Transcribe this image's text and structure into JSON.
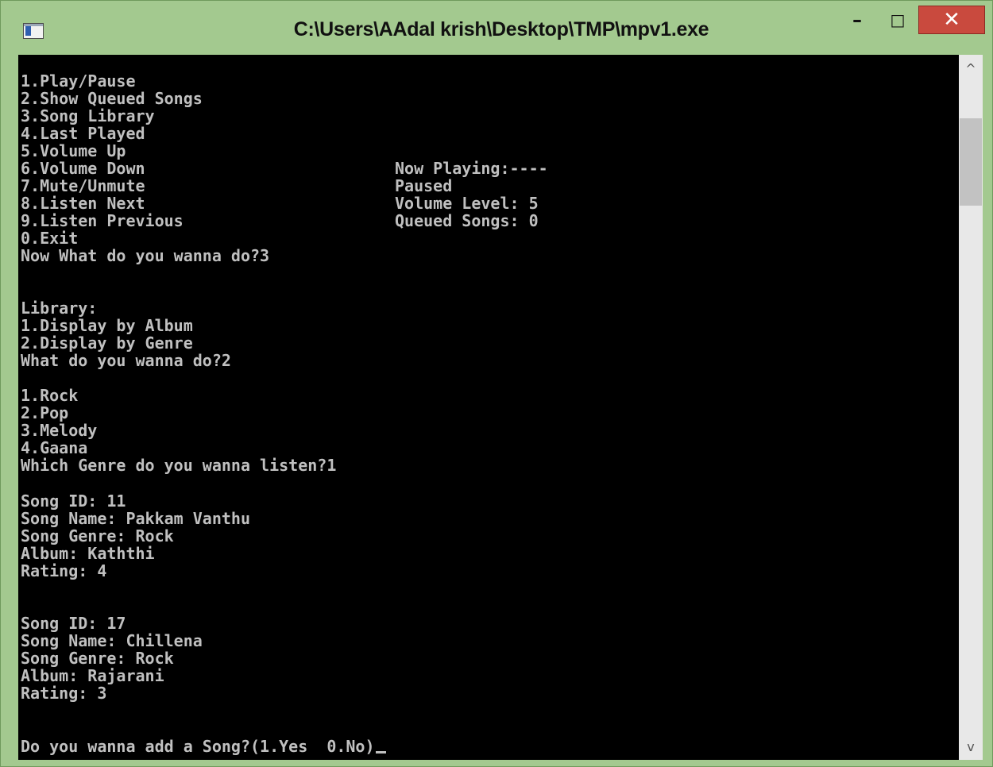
{
  "window": {
    "title": "C:\\Users\\AAdal krish\\Desktop\\TMP\\mpv1.exe",
    "minimize_label": "–",
    "maximize_label": "□",
    "close_label": "✕"
  },
  "menu": [
    "1.Play/Pause",
    "2.Show Queued Songs",
    "3.Song Library",
    "4.Last Played",
    "5.Volume Up",
    "6.Volume Down",
    "7.Mute/Unmute",
    "8.Listen Next",
    "9.Listen Previous",
    "0.Exit",
    "Now What do you wanna do?3"
  ],
  "status": [
    "Now Playing:----",
    "Paused",
    "Volume Level: 5",
    "Queued Songs: 0"
  ],
  "library": [
    "Library:",
    "1.Display by Album",
    "2.Display by Genre",
    "What do you wanna do?2"
  ],
  "genres": [
    "1.Rock",
    "2.Pop",
    "3.Melody",
    "4.Gaana",
    "Which Genre do you wanna listen?1"
  ],
  "song1": [
    "Song ID: 11",
    "Song Name: Pakkam Vanthu",
    "Song Genre: Rock",
    "Album: Kaththi",
    "Rating: 4"
  ],
  "song2": [
    "Song ID: 17",
    "Song Name: Chillena",
    "Song Genre: Rock",
    "Album: Rajarani",
    "Rating: 3"
  ],
  "prompt": "Do you wanna add a Song?(1.Yes  0.No)",
  "scrollbar": {
    "up_arrow": "^",
    "down_arrow": "v"
  }
}
